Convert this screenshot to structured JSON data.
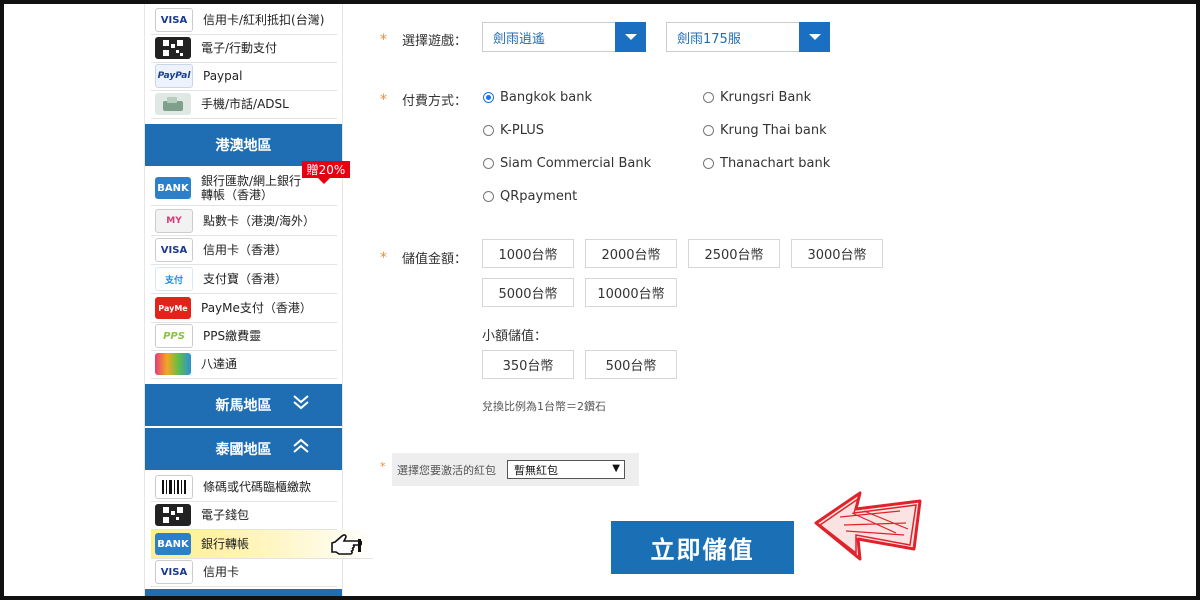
{
  "sidebar": {
    "top_items": [
      {
        "label": "信用卡/紅利抵扣(台灣)",
        "icon": "visa-card-icon",
        "icon_text": "VISA"
      },
      {
        "label": "電子/行動支付",
        "icon": "qr-code-icon",
        "icon_text": ""
      },
      {
        "label": "Paypal",
        "icon": "paypal-icon",
        "icon_text": "PayPal"
      },
      {
        "label": "手機/市話/ADSL",
        "icon": "phone-icon",
        "icon_text": ""
      }
    ],
    "hk_header": "港澳地區",
    "hk_promo": "贈20%",
    "hk_items": [
      {
        "label": "銀行匯款/網上銀行轉帳（香港）",
        "icon": "bank-card-icon",
        "icon_text": "BANK"
      },
      {
        "label": "點數卡（港澳/海外）",
        "icon": "mycard-icon",
        "icon_text": "MY"
      },
      {
        "label": "信用卡（香港）",
        "icon": "visa-card-icon",
        "icon_text": "VISA"
      },
      {
        "label": "支付寶（香港）",
        "icon": "alipay-icon",
        "icon_text": "支付"
      },
      {
        "label": "PayMe支付（香港）",
        "icon": "payme-icon",
        "icon_text": "PayMe"
      },
      {
        "label": "PPS繳費靈",
        "icon": "pps-icon",
        "icon_text": "PPS"
      },
      {
        "label": "八達通",
        "icon": "octopus-icon",
        "icon_text": ""
      }
    ],
    "sgmy_header": "新馬地區",
    "th_header": "泰國地區",
    "th_items": [
      {
        "label": "條碼或代碼臨櫃繳款",
        "icon": "barcode-icon",
        "icon_text": ""
      },
      {
        "label": "電子錢包",
        "icon": "qr-code-icon",
        "icon_text": ""
      },
      {
        "label": "銀行轉帳",
        "icon": "bank-card-icon",
        "icon_text": "BANK"
      },
      {
        "label": "信用卡",
        "icon": "visa-card-icon",
        "icon_text": "VISA"
      }
    ]
  },
  "form": {
    "required_mark": "*",
    "game_label": "選擇遊戲：",
    "game_value": "劍雨逍遙",
    "server_value": "劍雨175服",
    "payment_label": "付費方式：",
    "payment_options": [
      {
        "label": "Bangkok bank",
        "selected": true
      },
      {
        "label": "Krungsri Bank",
        "selected": false
      },
      {
        "label": "K-PLUS",
        "selected": false
      },
      {
        "label": "Krung Thai bank",
        "selected": false
      },
      {
        "label": "Siam Commercial Bank",
        "selected": false
      },
      {
        "label": "Thanachart bank",
        "selected": false
      },
      {
        "label": "QRpayment",
        "selected": false
      }
    ],
    "amount_label": "儲值金額：",
    "amounts": [
      "1000台幣",
      "2000台幣",
      "2500台幣",
      "3000台幣",
      "5000台幣",
      "10000台幣"
    ],
    "small_label": "小額儲值：",
    "small_amounts": [
      "350台幣",
      "500台幣"
    ],
    "ratio_note": "兌換比例為1台幣＝2鑽石",
    "coupon_label": "選擇您要激活的紅包",
    "coupon_value": "暫無紅包",
    "submit_label": "立即儲值"
  },
  "colors": {
    "brand_blue": "#1f6db3",
    "promo_red": "#e60012",
    "required_orange": "#e98b3a",
    "arrow_red": "#e0232b"
  }
}
